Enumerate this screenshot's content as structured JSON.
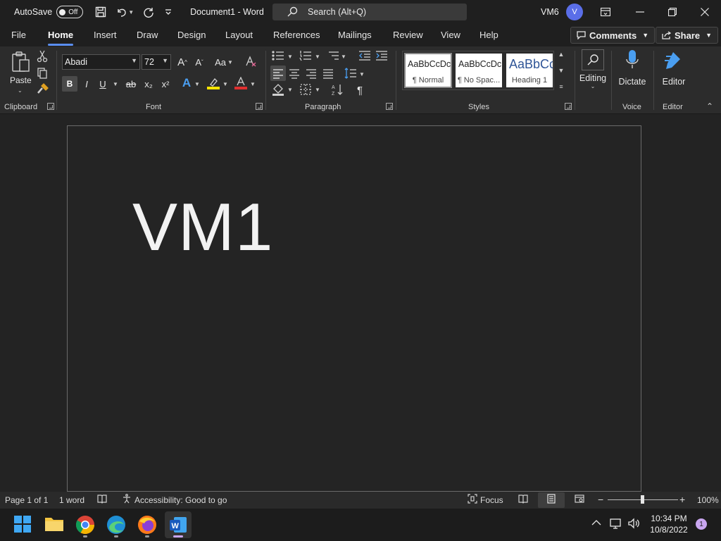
{
  "titlebar": {
    "autosave_label": "AutoSave",
    "autosave_state": "Off",
    "document_title": "Document1  -  Word",
    "search_placeholder": "Search (Alt+Q)",
    "user_name": "VM6",
    "avatar_initial": "V"
  },
  "tabs": [
    "File",
    "Home",
    "Insert",
    "Draw",
    "Design",
    "Layout",
    "References",
    "Mailings",
    "Review",
    "View",
    "Help"
  ],
  "active_tab": "Home",
  "actions": {
    "comments": "Comments",
    "share": "Share"
  },
  "ribbon": {
    "clipboard": {
      "paste": "Paste",
      "group": "Clipboard"
    },
    "font": {
      "family": "Abadi",
      "size": "72",
      "group": "Font",
      "grow": "A^",
      "shrink": "Aˇ",
      "case": "Aa",
      "bold": "B",
      "italic": "I",
      "underline": "U",
      "strike": "ab",
      "subscript": "x₂",
      "superscript": "x²"
    },
    "paragraph": {
      "group": "Paragraph"
    },
    "styles": {
      "group": "Styles",
      "items": [
        {
          "sample": "AaBbCcDc",
          "name": "¶ Normal"
        },
        {
          "sample": "AaBbCcDc",
          "name": "¶ No Spac..."
        },
        {
          "sample": "AaBbCc",
          "name": "Heading 1"
        }
      ]
    },
    "editing": {
      "label": "Editing"
    },
    "voice": {
      "dictate": "Dictate",
      "group": "Voice"
    },
    "editor": {
      "label": "Editor",
      "group": "Editor"
    }
  },
  "document": {
    "body_text": "VM1"
  },
  "statusbar": {
    "page": "Page 1 of 1",
    "words": "1 word",
    "accessibility": "Accessibility: Good to go",
    "focus": "Focus",
    "zoom_minus": "−",
    "zoom_plus": "+",
    "zoom": "100%"
  },
  "taskbar": {
    "time": "10:34 PM",
    "date": "10/8/2022",
    "notifications": "1"
  },
  "colors": {
    "accent": "#5a8ef0",
    "avatar": "#5a6ee8",
    "highlight_yellow": "#f5e400",
    "font_red": "#e03030"
  }
}
